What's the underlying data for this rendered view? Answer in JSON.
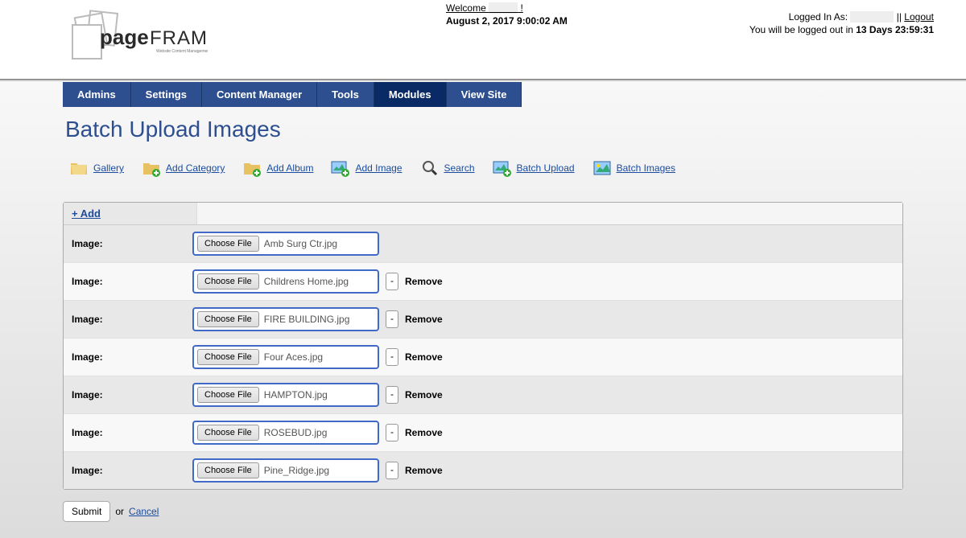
{
  "header": {
    "welcome_prefix": "Welcome ",
    "welcome_suffix": " !",
    "datetime": "August 2, 2017 9:00:02 AM",
    "logged_in_as_label": "Logged In As: ",
    "separator": " || ",
    "logout": "Logout",
    "logout_warning_prefix": "You will be logged out in ",
    "logout_countdown": "13 Days 23:59:31"
  },
  "nav": {
    "items": [
      "Admins",
      "Settings",
      "Content Manager",
      "Tools",
      "Modules",
      "View Site"
    ],
    "active": "Modules"
  },
  "page": {
    "title": "Batch Upload Images"
  },
  "toolbar": {
    "gallery": "Gallery",
    "add_category": "Add Category",
    "add_album": "Add Album",
    "add_image": "Add Image",
    "search": "Search",
    "batch_upload": "Batch Upload",
    "batch_images": "Batch Images"
  },
  "panel": {
    "add_label": "+ Add",
    "row_label": "Image:",
    "choose_label": "Choose File",
    "remove_label": "Remove",
    "rows": [
      {
        "filename": "Amb Surg Ctr.jpg",
        "removable": false
      },
      {
        "filename": "Childrens Home.jpg",
        "removable": true
      },
      {
        "filename": "FIRE BUILDING.jpg",
        "removable": true
      },
      {
        "filename": "Four Aces.jpg",
        "removable": true
      },
      {
        "filename": "HAMPTON.jpg",
        "removable": true
      },
      {
        "filename": "ROSEBUD.jpg",
        "removable": true
      },
      {
        "filename": "Pine_Ridge.jpg",
        "removable": true
      }
    ]
  },
  "footer": {
    "submit": "Submit",
    "or": "or",
    "cancel": "Cancel"
  }
}
